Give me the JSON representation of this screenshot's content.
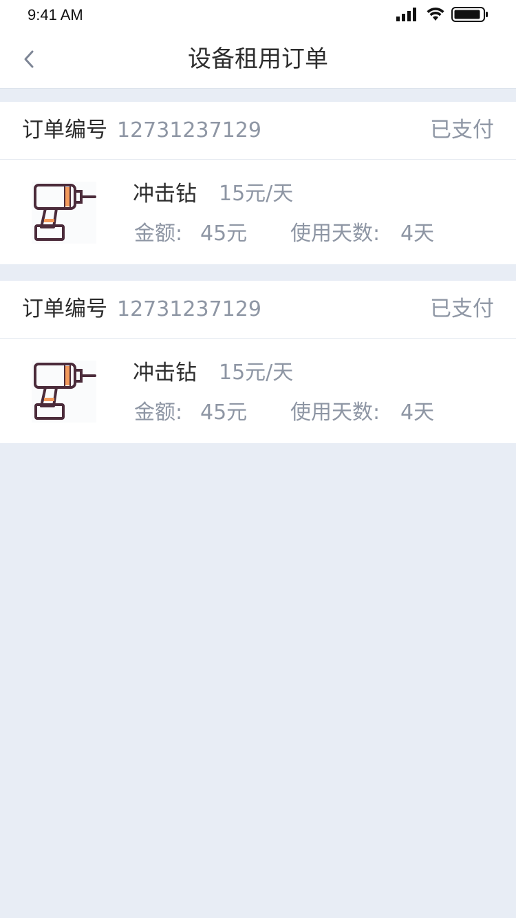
{
  "status_bar": {
    "time": "9:41 AM"
  },
  "nav": {
    "title": "设备租用订单",
    "back_icon": "chevron-left-icon"
  },
  "orders": [
    {
      "order_no_label": "订单编号",
      "order_no": "12731237129",
      "status": "已支付",
      "product": {
        "icon": "drill-icon",
        "name": "冲击钻",
        "price": "15元/天"
      },
      "amount_label": "金额:",
      "amount_value": "45元",
      "days_label": "使用天数:",
      "days_value": "4天"
    },
    {
      "order_no_label": "订单编号",
      "order_no": "12731237129",
      "status": "已支付",
      "product": {
        "icon": "drill-icon",
        "name": "冲击钻",
        "price": "15元/天"
      },
      "amount_label": "金额:",
      "amount_value": "45元",
      "days_label": "使用天数:",
      "days_value": "4天"
    }
  ],
  "colors": {
    "background": "#e8edf5",
    "card": "#ffffff",
    "primary_text": "#2d2d2d",
    "secondary_text": "#8e96a4",
    "icon_outline": "#4b2b3a",
    "icon_accent": "#f39a5c"
  }
}
